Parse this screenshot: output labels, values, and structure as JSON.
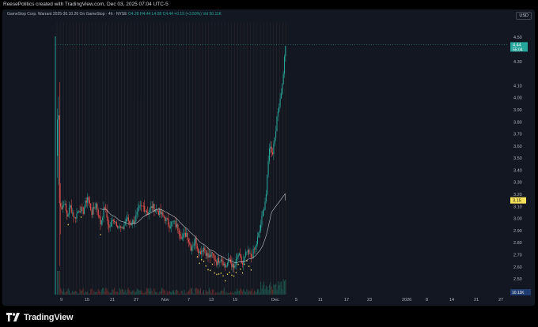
{
  "header": {
    "attribution": "ReesePolitics created with TradingView.com, Dec 03, 2025 07:04 UTC-5"
  },
  "legend": {
    "symbol": "GameStop Corp. Warrant 2025-30.10.26 On GameStop · 4h · NYSE",
    "ohlc": "O4.28 H4.44 L4.08 C4.44 +0.15 (+3.50%)",
    "volume": "Vol 50.11K"
  },
  "currency": "USD",
  "footer": {
    "brand": "TradingView"
  },
  "colors": {
    "up": "#26a69a",
    "down": "#ef5350",
    "ma": "#d1d4dc",
    "bg": "#131722",
    "marker": "#f7e05a"
  },
  "chart_data": {
    "type": "candlestick",
    "y_ticks": [
      4.5,
      4.4,
      4.3,
      4.1,
      4.0,
      3.9,
      3.8,
      3.7,
      3.6,
      3.5,
      3.4,
      3.3,
      3.2,
      3.1,
      3.0,
      2.9,
      2.8,
      2.7,
      2.6,
      2.5,
      2.4
    ],
    "x_labels": [
      "9",
      "15",
      "21",
      "27",
      "Nov",
      "7",
      "13",
      "19",
      "Dec",
      "5",
      "11",
      "17",
      "23",
      "2026",
      "8",
      "14",
      "21",
      "27"
    ],
    "ylim": [
      2.37,
      4.56
    ],
    "last_price": 4.44,
    "last_price_countdown": "55:04",
    "ma_value": 3.15,
    "volume_label": "10.11K",
    "close_path": [
      [
        0,
        3.82
      ],
      [
        1,
        3.85
      ],
      [
        2,
        3.15
      ],
      [
        4,
        3.08
      ],
      [
        6,
        3.14
      ],
      [
        9,
        3.02
      ],
      [
        12,
        3.1
      ],
      [
        16,
        3.0
      ],
      [
        20,
        3.08
      ],
      [
        24,
        3.06
      ],
      [
        28,
        3.18
      ],
      [
        32,
        3.05
      ],
      [
        36,
        3.12
      ],
      [
        40,
        2.96
      ],
      [
        44,
        3.1
      ],
      [
        48,
        2.92
      ],
      [
        52,
        3.0
      ],
      [
        56,
        2.95
      ],
      [
        60,
        2.9
      ],
      [
        64,
        3.0
      ],
      [
        68,
        2.96
      ],
      [
        72,
        2.99
      ],
      [
        76,
        3.08
      ],
      [
        80,
        3.1
      ],
      [
        84,
        3.05
      ],
      [
        88,
        3.1
      ],
      [
        92,
        3.07
      ],
      [
        96,
        3.04
      ],
      [
        100,
        3.0
      ],
      [
        104,
        2.95
      ],
      [
        108,
        2.97
      ],
      [
        112,
        2.92
      ],
      [
        116,
        2.84
      ],
      [
        120,
        2.88
      ],
      [
        124,
        2.76
      ],
      [
        128,
        2.82
      ],
      [
        132,
        2.72
      ],
      [
        136,
        2.76
      ],
      [
        140,
        2.68
      ],
      [
        144,
        2.7
      ],
      [
        148,
        2.64
      ],
      [
        152,
        2.68
      ],
      [
        156,
        2.6
      ],
      [
        160,
        2.66
      ],
      [
        164,
        2.58
      ],
      [
        168,
        2.7
      ],
      [
        172,
        2.62
      ],
      [
        176,
        2.72
      ],
      [
        180,
        2.68
      ],
      [
        184,
        2.76
      ],
      [
        188,
        2.9
      ],
      [
        191,
        3.05
      ],
      [
        194,
        3.2
      ],
      [
        197,
        3.6
      ],
      [
        200,
        3.55
      ],
      [
        203,
        3.75
      ],
      [
        206,
        3.95
      ],
      [
        209,
        4.1
      ],
      [
        212,
        4.44
      ]
    ]
  }
}
